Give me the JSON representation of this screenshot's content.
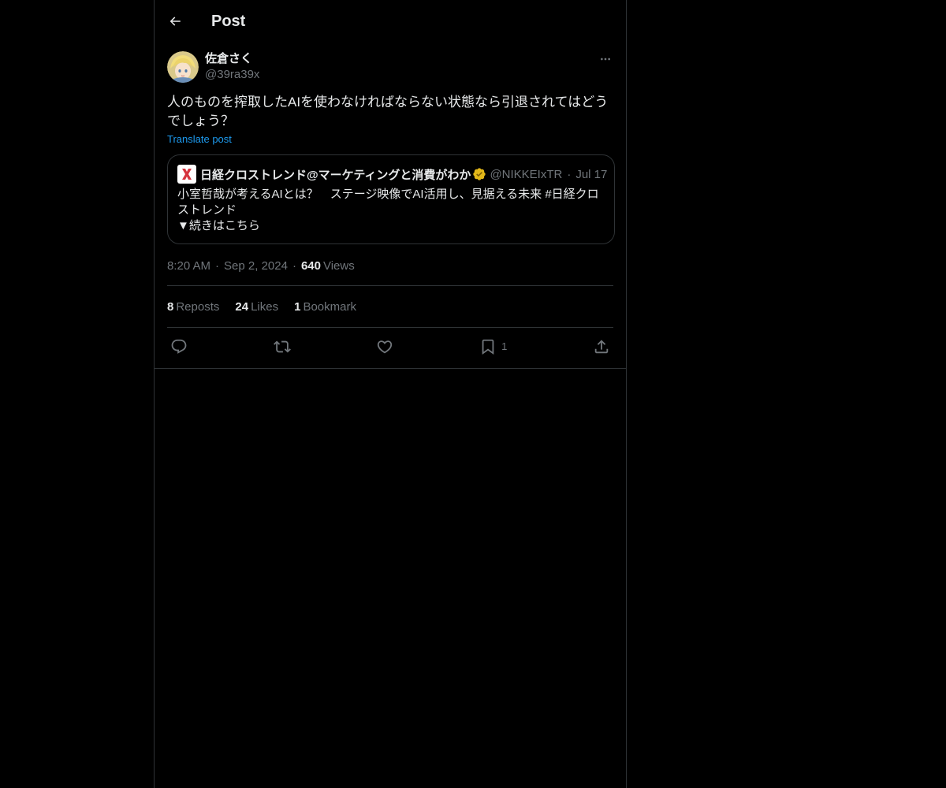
{
  "header": {
    "title": "Post",
    "back_icon": "arrow-left-icon"
  },
  "post": {
    "author": {
      "display_name": "佐倉さく",
      "handle": "@39ra39x",
      "avatar_icon": "avatar-anime-character"
    },
    "text": "人のものを搾取したAIを使わなければならない状態なら引退されてはどうでしょう？",
    "translate_label": "Translate post",
    "quote": {
      "name": "日経クロストレンド@マーケティングと消費がわか",
      "handle": "@NIKKEIxTR",
      "date": "Jul 17",
      "body_line1": "小室哲哉が考えるAIとは？　ステージ映像でAI活用し、見据える未来 #日経クロストレンド",
      "body_line2": "▼続きはこちら",
      "verified_color": "#e2b719"
    },
    "meta": {
      "time": "8:20 AM",
      "date": "Sep 2, 2024",
      "views_count": "640",
      "views_label": "Views"
    },
    "stats": {
      "reposts_count": "8",
      "reposts_label": "Reposts",
      "likes_count": "24",
      "likes_label": "Likes",
      "bookmarks_count": "1",
      "bookmarks_label": "Bookmark"
    },
    "actions": {
      "reply_icon": "reply-icon",
      "repost_icon": "repost-icon",
      "like_icon": "heart-icon",
      "bookmark_icon": "bookmark-icon",
      "bookmark_count": "1",
      "share_icon": "share-icon"
    }
  },
  "colors": {
    "background": "#000000",
    "text_primary": "#e7e9ea",
    "text_secondary": "#71767b",
    "accent": "#1d9bf0",
    "border": "#2f3336"
  }
}
